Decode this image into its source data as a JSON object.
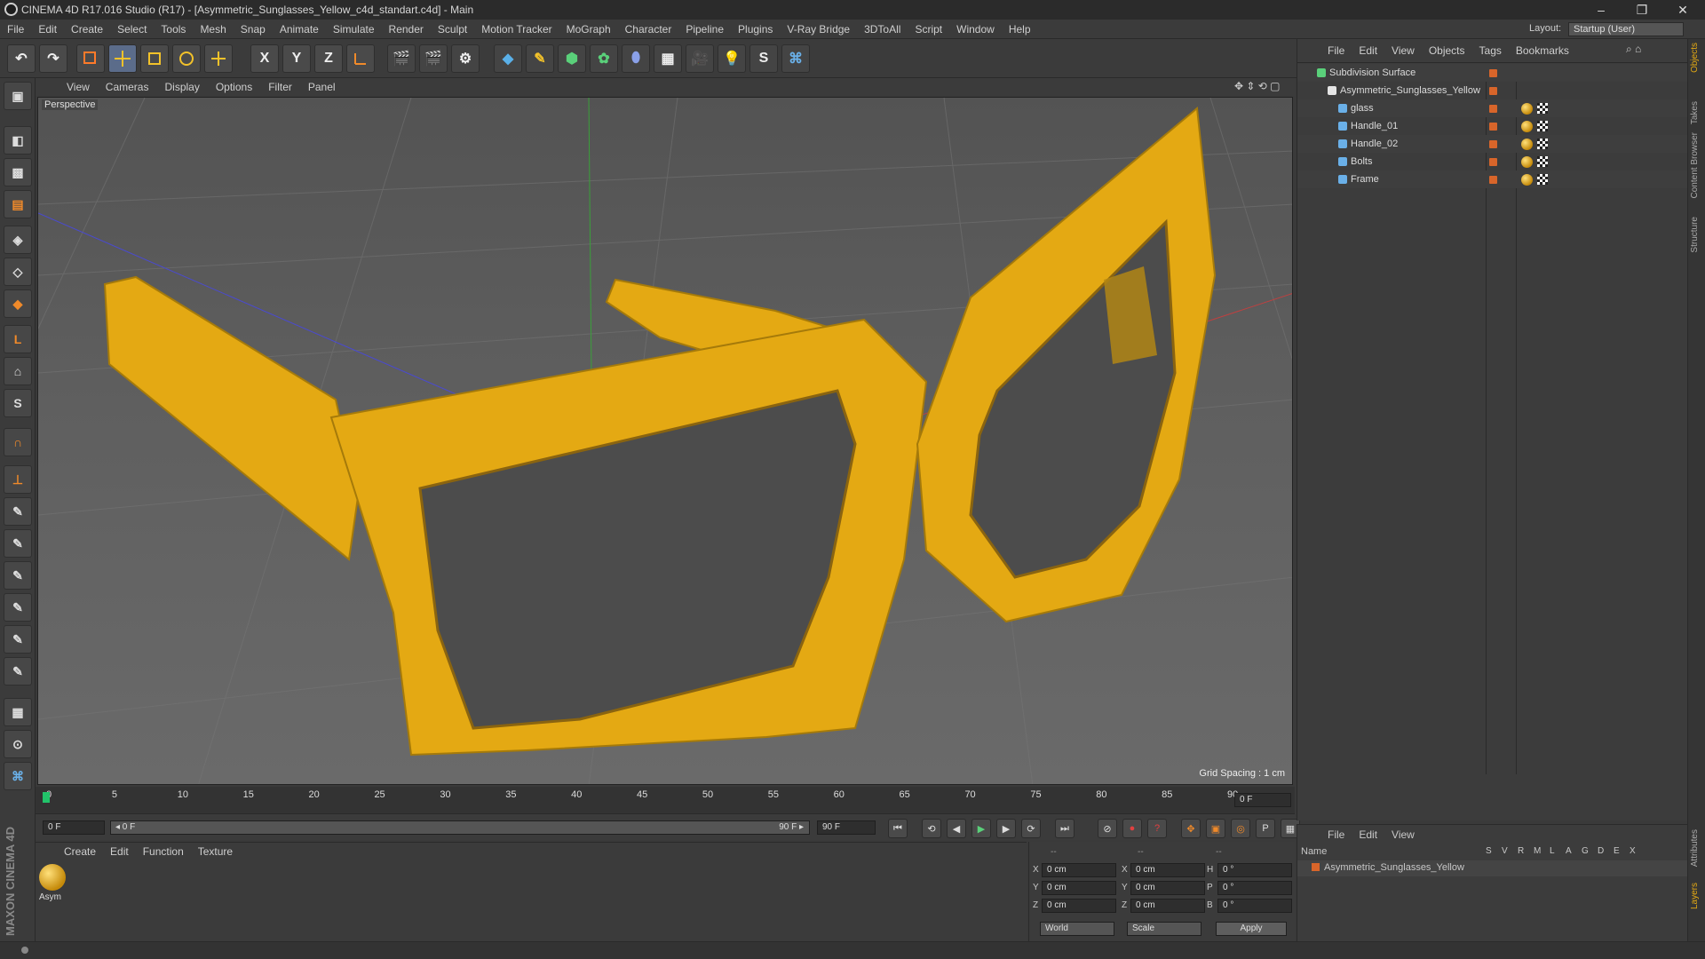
{
  "window": {
    "title": "CINEMA 4D R17.016 Studio (R17) - [Asymmetric_Sunglasses_Yellow_c4d_standart.c4d] - Main",
    "controls": [
      "–",
      "❐",
      "✕"
    ]
  },
  "menubar": [
    "File",
    "Edit",
    "Create",
    "Select",
    "Tools",
    "Mesh",
    "Snap",
    "Animate",
    "Simulate",
    "Render",
    "Sculpt",
    "Motion Tracker",
    "MoGraph",
    "Character",
    "Pipeline",
    "Plugins",
    "V-Ray Bridge",
    "3DToAll",
    "Script",
    "Window",
    "Help"
  ],
  "layout": {
    "label": "Layout:",
    "value": "Startup (User)"
  },
  "toolbar": {
    "undo_icon": "undo-icon",
    "axis_labels": [
      "X",
      "Y",
      "Z"
    ]
  },
  "viewport": {
    "menus": [
      "View",
      "Cameras",
      "Display",
      "Options",
      "Filter",
      "Panel"
    ],
    "camera_label": "Perspective",
    "grid_spacing": "Grid Spacing : 1 cm"
  },
  "timeline": {
    "ticks": [
      "0",
      "5",
      "10",
      "15",
      "20",
      "25",
      "30",
      "35",
      "40",
      "45",
      "50",
      "55",
      "60",
      "65",
      "70",
      "75",
      "80",
      "85",
      "90"
    ],
    "current_frame_right": "0 F"
  },
  "playbar": {
    "start_field": "0 F",
    "range_start": "◂ 0 F",
    "range_end": "90 F ▸",
    "end_field": "90 F"
  },
  "material_manager": {
    "menus": [
      "Create",
      "Edit",
      "Function",
      "Texture"
    ],
    "material_label": "Asym"
  },
  "coordinates": {
    "rows": [
      {
        "a": "X",
        "av": "0 cm",
        "b": "X",
        "bv": "0 cm",
        "c": "H",
        "cv": "0 °"
      },
      {
        "a": "Y",
        "av": "0 cm",
        "b": "Y",
        "bv": "0 cm",
        "c": "P",
        "cv": "0 °"
      },
      {
        "a": "Z",
        "av": "0 cm",
        "b": "Z",
        "bv": "0 cm",
        "c": "B",
        "cv": "0 °"
      }
    ],
    "space": "World",
    "mode": "Scale",
    "apply": "Apply",
    "header_dashes": [
      "--",
      "--",
      "--"
    ]
  },
  "object_manager": {
    "menus": [
      "File",
      "Edit",
      "View",
      "Objects",
      "Tags",
      "Bookmarks"
    ],
    "objects": [
      {
        "name": "Subdivision Surface",
        "indent": 0
      },
      {
        "name": "Asymmetric_Sunglasses_Yellow",
        "indent": 1
      },
      {
        "name": "glass",
        "indent": 2
      },
      {
        "name": "Handle_01",
        "indent": 2
      },
      {
        "name": "Handle_02",
        "indent": 2
      },
      {
        "name": "Bolts",
        "indent": 2
      },
      {
        "name": "Frame",
        "indent": 2
      }
    ]
  },
  "layer_manager": {
    "menus": [
      "File",
      "Edit",
      "View"
    ],
    "name_header": "Name",
    "columns": [
      "S",
      "V",
      "R",
      "M",
      "L",
      "A",
      "G",
      "D",
      "E",
      "X"
    ],
    "row": "Asymmetric_Sunglasses_Yellow"
  },
  "side_tabs": [
    "Objects",
    "Takes",
    "Content Browser",
    "Structure"
  ],
  "side_tabs_lower": [
    "Attributes",
    "Layers"
  ],
  "brand": "MAXON CINEMA 4D",
  "colors": {
    "accent": "#e4a913",
    "orange": "#d8652a",
    "bg": "#3b3b3b"
  }
}
